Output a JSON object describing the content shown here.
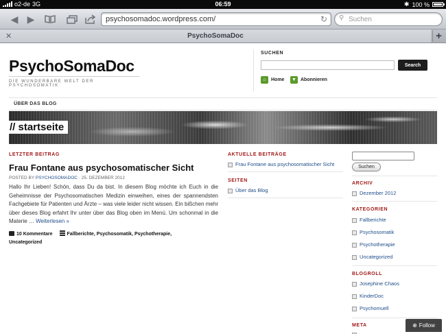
{
  "status_bar": {
    "carrier": "o2-de",
    "network": "3G",
    "time": "06:59",
    "battery": "100 %"
  },
  "browser": {
    "url": "psychosomadoc.wordpress.com/",
    "search_placeholder": "Suchen",
    "tab_title": "PsychoSomaDoc"
  },
  "site": {
    "title": "PsychoSomaDoc",
    "tagline": "DIE WUNDERBARE WELT DER PSYCHOSOMATIK",
    "search_label": "SUCHEN",
    "search_button": "Search",
    "home_link": "Home",
    "subscribe_link": "Abonnieren",
    "nav_item": "ÜBER DAS BLOG",
    "banner_title": "// startseite"
  },
  "main": {
    "section_label": "LETZTER BEITRAG",
    "post_title": "Frau Fontane aus psychosomatischer Sicht",
    "posted_by": "POSTED BY",
    "author": "PSYCHOSOMADOC",
    "date": "· 25. DEZEMBER 2012",
    "body": "Hallo Ihr Lieben! Schön, dass Du da bist. In diesem Blog möchte ich Euch in die Geheimnisse der Psychosomatischen Medizin einweihen, eines der spannendsten Fachgebiete für Patienten und Ärzte – was viele leider nicht wissen. Ein bißchen mehr über dieses Blog erfahrt Ihr unter über das Blog oben im Menü. Um schonmal in die Materie …",
    "read_more": "Weiterlesen »",
    "comments": "10 Kommentare",
    "tags_line1": "Fallberichte, Psychosomatik, Psychotherapie,",
    "tags_line2": "Uncategorized"
  },
  "middle": {
    "recent_label": "AKTUELLE BEITRÄGE",
    "recent_items": [
      "Frau Fontane aus psychosomatischer Sicht"
    ],
    "pages_label": "SEITEN",
    "pages_items": [
      "Über das Blog"
    ]
  },
  "right": {
    "search_button": "Suchen",
    "archive_label": "ARCHIV",
    "archive_items": [
      "Dezember 2012"
    ],
    "categories_label": "KATEGORIEN",
    "categories_items": [
      "Fallberichte",
      "Psychosomatik",
      "Psychotherapie",
      "Uncategorized"
    ],
    "blogroll_label": "BLOGROLL",
    "blogroll_items": [
      "Josephine Chaos",
      "KinderDoc",
      "Psychomuell"
    ],
    "meta_label": "META"
  },
  "follow_button": "Follow"
}
